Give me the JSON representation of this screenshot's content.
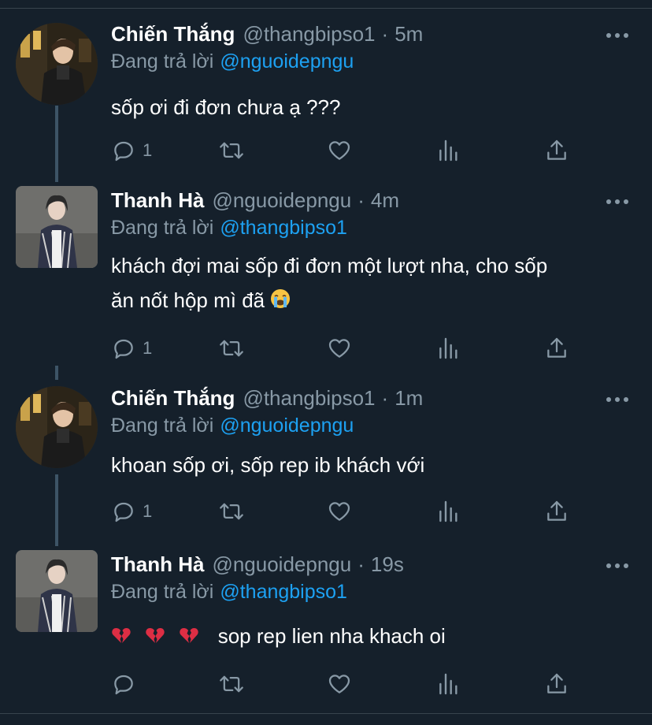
{
  "reply_prefix": "Đang trả lời",
  "tweets": [
    {
      "name": "Chiến Thắng",
      "handle": "@thangbipso1",
      "separator": "·",
      "time": "5m",
      "replying_to": "@nguoidepngu",
      "lines": [
        "sốp ơi đi đơn chưa ạ ???"
      ],
      "reply_count": "1"
    },
    {
      "name": "Thanh Hà",
      "handle": "@nguoidepngu",
      "separator": "·",
      "time": "4m",
      "replying_to": "@thangbipso1",
      "lines": [
        "khách đợi mai sốp đi đơn một lượt nha, cho sốp",
        "ăn nốt hộp mì đã"
      ],
      "emoji_after_text": "crying-face-emoji",
      "reply_count": "1"
    },
    {
      "name": "Chiến Thắng",
      "handle": "@thangbipso1",
      "separator": "·",
      "time": "1m",
      "replying_to": "@nguoidepngu",
      "lines": [
        "khoan sốp ơi, sốp rep ib khách với"
      ],
      "reply_count": "1"
    },
    {
      "name": "Thanh Hà",
      "handle": "@nguoidepngu",
      "separator": "·",
      "time": "19s",
      "replying_to": "@thangbipso1",
      "lines": [
        "sop rep lien nha khach oi"
      ],
      "emoji_before_text": [
        "broken-heart-emoji",
        "broken-heart-emoji",
        "broken-heart-emoji"
      ],
      "reply_count": ""
    }
  ],
  "colors": {
    "background": "#15202b",
    "secondary_text": "#8899a6",
    "link": "#1da1f2",
    "thread_line": "#3d5466",
    "divider": "#38444d"
  },
  "icons": [
    "reply-icon",
    "retweet-icon",
    "like-icon",
    "analytics-icon",
    "share-icon",
    "more-icon"
  ]
}
